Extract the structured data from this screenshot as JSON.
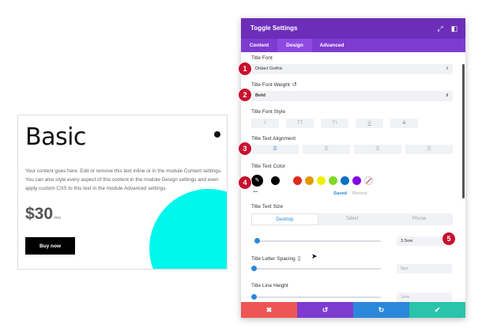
{
  "card": {
    "title": "Basic",
    "body": "Your content goes here. Edit or remove this text inline or in the module Content settings. You can also style every aspect of this content in the module Design settings and even apply custom CSS to this text in the module Advanced settings.",
    "price": "$30",
    "price_unit": "/mo",
    "button_label": "Buy now",
    "accent_color": "#00f7ec"
  },
  "panel": {
    "title": "Toggle Settings",
    "header_color": "#6c2eb9",
    "tabs": [
      {
        "label": "Content"
      },
      {
        "label": "Design",
        "active": true
      },
      {
        "label": "Advanced"
      }
    ],
    "title_font": {
      "label": "Title Font",
      "value": "Didact Gothic"
    },
    "title_font_weight": {
      "label": "Title Font Weight",
      "value": "Bold"
    },
    "title_font_style": {
      "label": "Title Font Style",
      "options": [
        "I",
        "TT",
        "Tт",
        "U",
        "S"
      ]
    },
    "title_text_alignment": {
      "label": "Title Text Alignment",
      "options": [
        "align-left-icon",
        "align-center-icon",
        "align-right-icon",
        "align-justify-icon"
      ],
      "selected": "align-left-icon"
    },
    "title_text_color": {
      "label": "Title Text Color",
      "current": "#000000",
      "swatches": [
        "#000000",
        "#e02b20",
        "#e09900",
        "#edf000",
        "#7cda24",
        "#0c71c3",
        "#8300e9"
      ],
      "saved_label": "Saved",
      "recent_label": "Recent",
      "more_label": "•••"
    },
    "title_text_size": {
      "label": "Title Text Size",
      "device_tabs": [
        "Desktop",
        "Tablet",
        "Phone"
      ],
      "active_device": "Desktop",
      "value": "3.5vw",
      "slider_fraction": 0.0
    },
    "title_letter_spacing": {
      "label": "Title Letter Spacing",
      "value": "0px",
      "slider_fraction": 0.0
    },
    "title_line_height": {
      "label": "Title Line Height",
      "value": "1em",
      "slider_fraction": 0.0
    },
    "footer": [
      {
        "name": "discard",
        "glyph": "✖",
        "color": "#ef5555"
      },
      {
        "name": "undo",
        "glyph": "↺",
        "color": "#7e3bd0"
      },
      {
        "name": "redo",
        "glyph": "↻",
        "color": "#2b87da"
      },
      {
        "name": "save",
        "glyph": "✔",
        "color": "#29c4a9"
      }
    ]
  },
  "markers": [
    "1",
    "2",
    "3",
    "4",
    "5"
  ]
}
